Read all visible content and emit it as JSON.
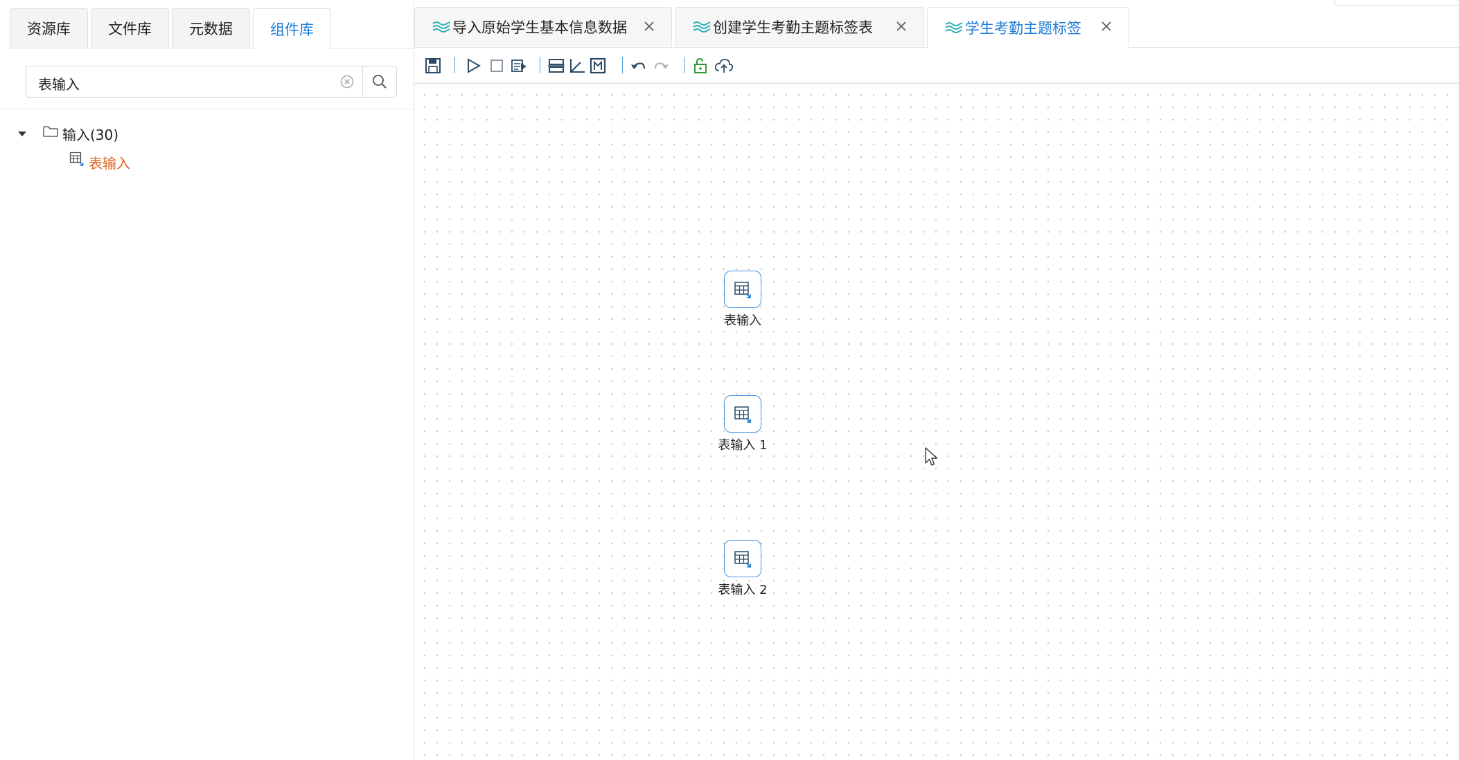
{
  "left_panel": {
    "tabs": [
      {
        "label": "资源库",
        "active": false
      },
      {
        "label": "文件库",
        "active": false
      },
      {
        "label": "元数据",
        "active": false
      },
      {
        "label": "组件库",
        "active": true
      }
    ],
    "search": {
      "value": "表输入"
    },
    "tree": {
      "folder": {
        "label": "输入(30)",
        "expanded": true
      },
      "leaf": {
        "label": "表输入"
      }
    }
  },
  "document_tabs": [
    {
      "label": "导入原始学生基本信息数据",
      "active": false
    },
    {
      "label": "创建学生考勤主题标签表",
      "active": false
    },
    {
      "label": "学生考勤主题标签",
      "active": true
    }
  ],
  "toolbar": {
    "icons": [
      "save-icon",
      "run-icon",
      "stop-icon",
      "preview-icon",
      "align-icon",
      "axis-icon",
      "layout-icon",
      "undo-icon",
      "redo-icon",
      "unlock-icon",
      "upload-icon"
    ]
  },
  "canvas": {
    "nodes": [
      {
        "label": "表输入"
      },
      {
        "label": "表输入 1"
      },
      {
        "label": "表输入 2"
      }
    ]
  },
  "colors": {
    "accent": "#1e7bd6",
    "leaf_highlight": "#e0611b",
    "node_border": "#4a90d9",
    "tab_icon": "#2fb3b7",
    "unlock": "#2e9b3a"
  }
}
